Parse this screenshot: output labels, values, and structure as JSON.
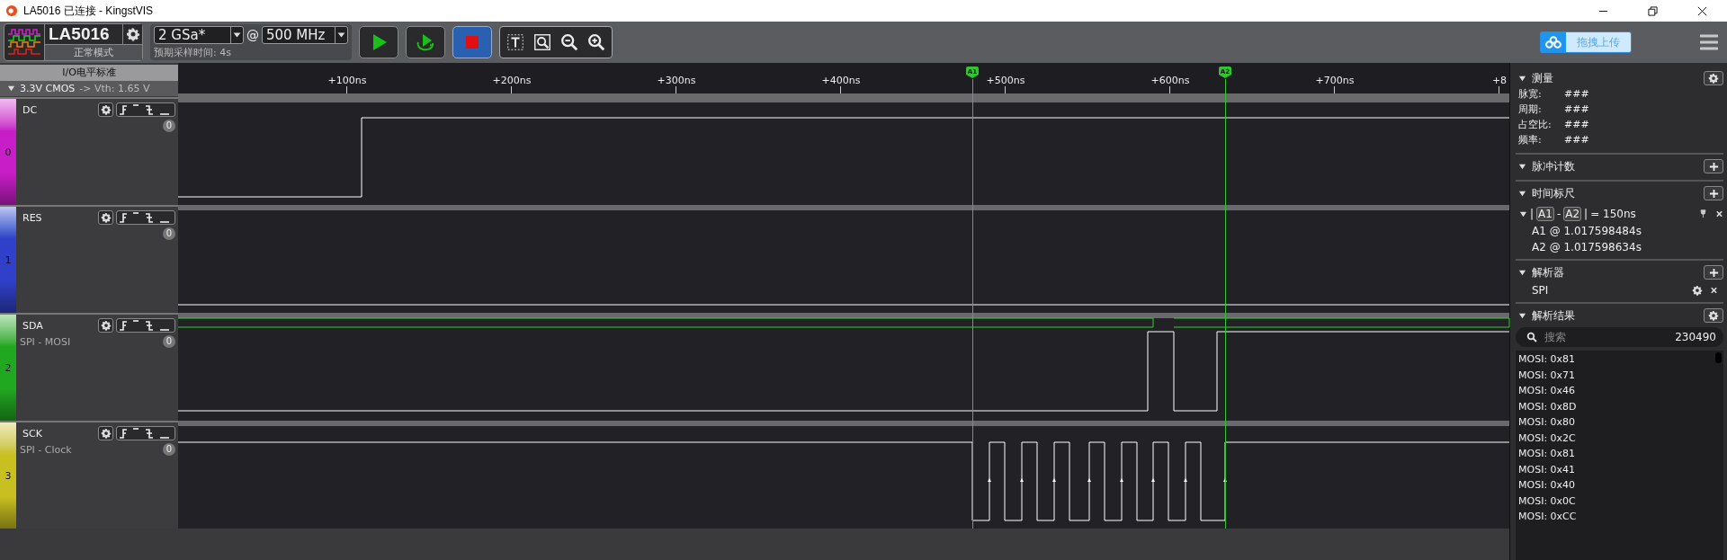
{
  "window": {
    "title": "LA5016 已连接 - KingstVIS"
  },
  "device": {
    "name": "LA5016",
    "mode": "正常模式"
  },
  "sample_depth": {
    "value": "2 GSa*"
  },
  "at": "@",
  "sample_rate": {
    "value": "500 MHz"
  },
  "expected_time": "预期采样时间: 4s",
  "capture_buttons": [
    {
      "kind": "start",
      "selected": false
    },
    {
      "kind": "loop",
      "selected": false
    },
    {
      "kind": "stop",
      "selected": true
    }
  ],
  "upload_button": "拖拽上传",
  "io_standard": {
    "title": "I/O电平标准",
    "value": "3.3V CMOS",
    "threshold": "-> Vth: 1.65 V"
  },
  "ruler": {
    "ticks": [
      "+100ns",
      "+200ns",
      "+300ns",
      "+400ns",
      "+500ns",
      "+600ns",
      "+700ns",
      "+8"
    ],
    "cursors": [
      "A1",
      "A2"
    ]
  },
  "channels": [
    {
      "index": "0",
      "name": "DC",
      "count": "0",
      "color": "#c81ec8",
      "kind": "dc"
    },
    {
      "index": "1",
      "name": "RES",
      "count": "0",
      "color": "#3040c8",
      "kind": "res"
    },
    {
      "index": "2",
      "name": "SDA",
      "decoder": "SPI - MOSI",
      "count": "0",
      "color": "#20a820",
      "kind": "sda"
    },
    {
      "index": "3",
      "name": "SCK",
      "decoder": "SPI - Clock",
      "count": "0",
      "color": "#c8c020",
      "kind": "sck"
    }
  ],
  "measure": {
    "title": "测量",
    "rows": [
      {
        "label": "脉宽:",
        "value": "###"
      },
      {
        "label": "周期:",
        "value": "###"
      },
      {
        "label": "占空比:",
        "value": "###"
      },
      {
        "label": "频率:",
        "value": "###"
      }
    ]
  },
  "pulse_count": {
    "title": "脉冲计数"
  },
  "time_ruler": {
    "title": "时间标尺",
    "open": "|",
    "a": "A1",
    "sep": "-",
    "b": "A2",
    "close": "|",
    "delta": "= 150ns",
    "lines": [
      "A1 @ 1.017598484s",
      "A2 @ 1.017598634s"
    ]
  },
  "decoders": {
    "title": "解析器",
    "items": [
      "SPI"
    ]
  },
  "results": {
    "title": "解析结果",
    "placeholder": "搜索",
    "count": "230490",
    "rows": [
      "MOSI: 0x81",
      "MOSI: 0x71",
      "MOSI: 0x46",
      "MOSI: 0x8D",
      "MOSI: 0x80",
      "MOSI: 0x2C",
      "MOSI: 0x81",
      "MOSI: 0x41",
      "MOSI: 0x40",
      "MOSI: 0x0C",
      "MOSI: 0xCC"
    ]
  }
}
